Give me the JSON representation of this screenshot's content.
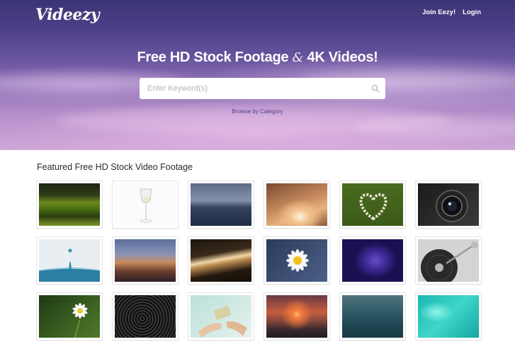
{
  "header": {
    "logo": "Videezy",
    "nav": [
      {
        "label": "Join Eezy!"
      },
      {
        "label": "Login"
      }
    ]
  },
  "hero": {
    "headline_part1": "Free HD Stock Footage",
    "headline_amp": "&",
    "headline_part2": "4K Videos!",
    "search": {
      "placeholder": "Enter Keyword(s)",
      "value": ""
    },
    "browse_link": "Browse by Category"
  },
  "featured": {
    "title": "Featured Free HD Stock Video Footage",
    "thumbnails": [
      {
        "subject": "green-landscape"
      },
      {
        "subject": "wine-glass"
      },
      {
        "subject": "city-skyline"
      },
      {
        "subject": "sun-rays"
      },
      {
        "subject": "pebble-heart"
      },
      {
        "subject": "camera-lens"
      },
      {
        "subject": "water-splash"
      },
      {
        "subject": "city-traffic-dusk"
      },
      {
        "subject": "light-streak"
      },
      {
        "subject": "daisy"
      },
      {
        "subject": "purple-jellyfish"
      },
      {
        "subject": "turntable"
      },
      {
        "subject": "white-flower"
      },
      {
        "subject": "star-trails"
      },
      {
        "subject": "money-hands"
      },
      {
        "subject": "sunset-beach"
      },
      {
        "subject": "ocean-water"
      },
      {
        "subject": "turquoise-water"
      }
    ]
  },
  "colors": {
    "hero_top": "#3b3574",
    "hero_bottom": "#cfa6d8",
    "link": "#4a3f86"
  }
}
